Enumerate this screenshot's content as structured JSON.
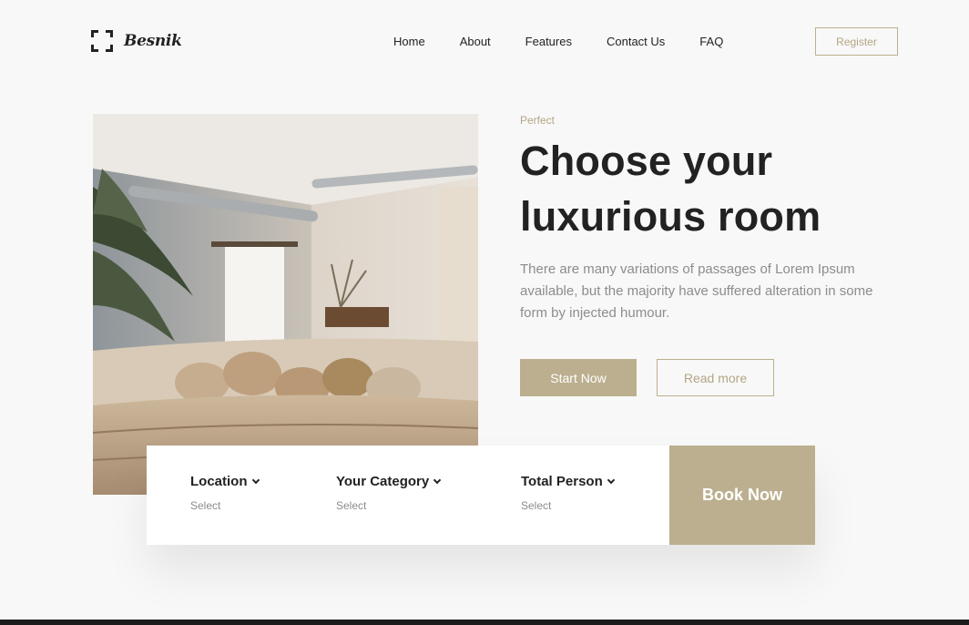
{
  "brand": {
    "name": "Besnik",
    "logo_icon": "bracket-frame-icon"
  },
  "nav": {
    "items": [
      {
        "label": "Home"
      },
      {
        "label": "About"
      },
      {
        "label": "Features"
      },
      {
        "label": "Contact Us"
      },
      {
        "label": "FAQ"
      }
    ],
    "register_label": "Register"
  },
  "hero": {
    "eyebrow": "Perfect",
    "headline": "Choose your luxurious room",
    "description": "There are many variations of passages of Lorem Ipsum available, but the majority have suffered alteration in some form by injected humour.",
    "primary_cta": "Start Now",
    "secondary_cta": "Read more"
  },
  "booking": {
    "fields": [
      {
        "label": "Location",
        "value": "Select",
        "icon": "chevron-down-icon"
      },
      {
        "label": "Your Category",
        "value": "Select",
        "icon": "chevron-down-icon"
      },
      {
        "label": "Total Person",
        "value": "Select",
        "icon": "chevron-down-icon"
      }
    ],
    "cta": "Book Now"
  },
  "colors": {
    "accent": "#bcaf8f",
    "accent_text": "#b3a684",
    "background": "#f8f8f8",
    "text": "#222222",
    "muted": "#8c8c8c"
  }
}
